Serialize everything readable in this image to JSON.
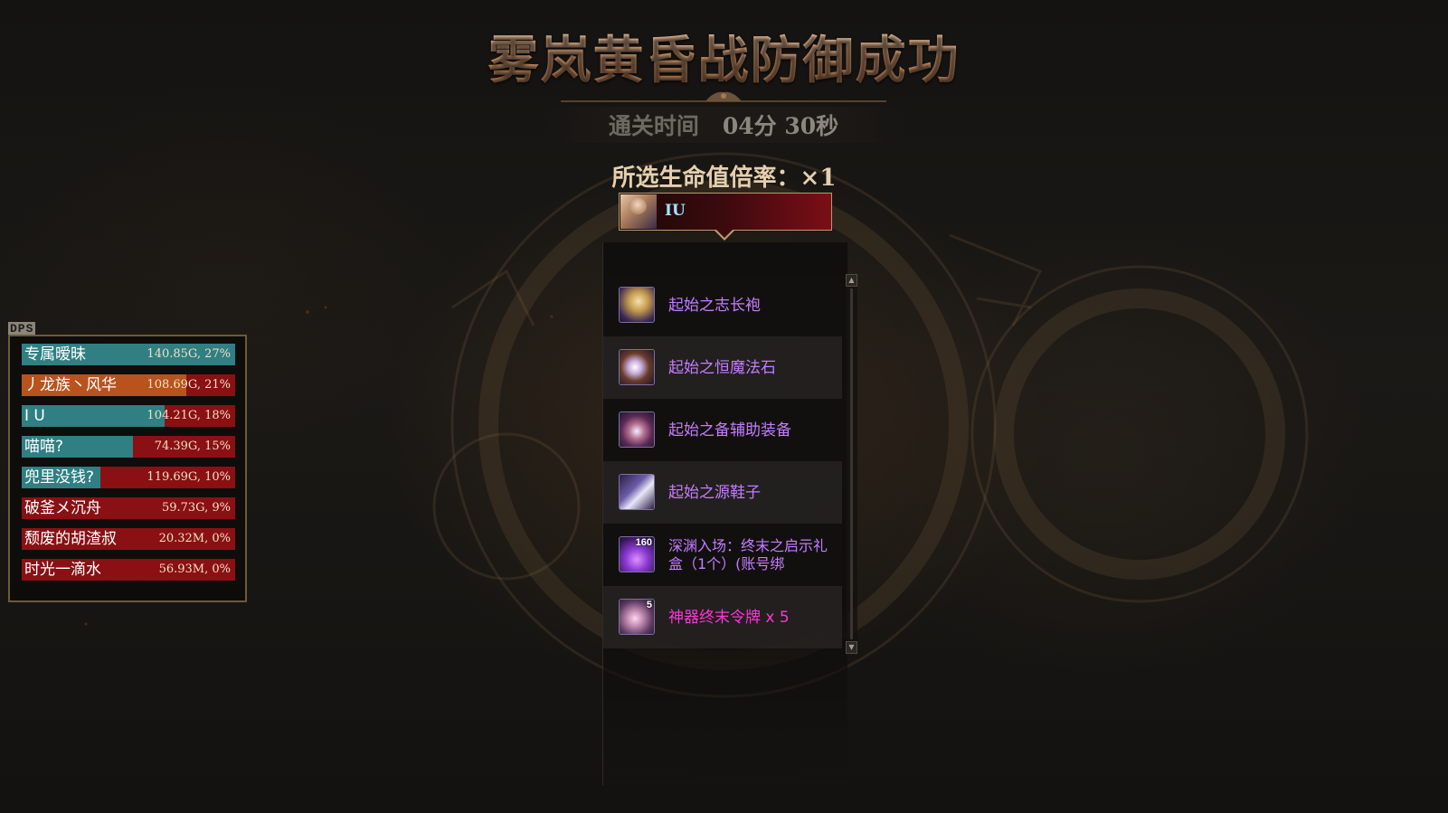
{
  "title": "雾岚黄昏战防御成功",
  "clear_time": {
    "label": "通关时间",
    "value": "04分 30秒"
  },
  "life_rate": "所选生命值倍率：×1",
  "player": {
    "name": "IU"
  },
  "colors": {
    "epic": "#c57cff",
    "legendary": "#ff35d8",
    "title_gold": "#d9a57a",
    "dps_red": "#8a1014",
    "dps_teal": "#2f7f83",
    "dps_orange": "#b9531e"
  },
  "rewards": [
    {
      "name": "起始之志长袍",
      "icon": "robe-icon",
      "rarity": "epic",
      "count": ""
    },
    {
      "name": "起始之恒魔法石",
      "icon": "magic-stone-icon",
      "rarity": "epic",
      "count": ""
    },
    {
      "name": "起始之备辅助装备",
      "icon": "support-gear-icon",
      "rarity": "epic",
      "count": ""
    },
    {
      "name": "起始之源鞋子",
      "icon": "boots-icon",
      "rarity": "epic",
      "count": ""
    },
    {
      "name": "深渊入场：终末之启示礼盒（1个）(账号绑",
      "icon": "gift-box-icon",
      "rarity": "epic",
      "count": "160"
    },
    {
      "name": "神器终末令牌 x 5",
      "icon": "token-icon",
      "rarity": "legendary",
      "count": "5"
    }
  ],
  "dps": {
    "label": "DPS",
    "rows": [
      {
        "name": "专属暧昧",
        "value": "140.85G, 27%",
        "fill": 1.0,
        "fill_color": "teal"
      },
      {
        "name": "丿龙族丶风华",
        "value": "108.69G, 21%",
        "fill": 0.77,
        "fill_color": "orange"
      },
      {
        "name": "I U",
        "value": "104.21G, 18%",
        "fill": 0.67,
        "fill_color": "teal"
      },
      {
        "name": "喵喵?",
        "value": "74.39G, 15%",
        "fill": 0.52,
        "fill_color": "teal"
      },
      {
        "name": "兜里没钱?",
        "value": "119.69G, 10%",
        "fill": 0.37,
        "fill_color": "teal"
      },
      {
        "name": "破釜メ沉舟",
        "value": "59.73G, 9%",
        "fill": 0.0,
        "fill_color": "teal"
      },
      {
        "name": "颓废的胡渣叔",
        "value": "20.32M, 0%",
        "fill": 0.0,
        "fill_color": "teal"
      },
      {
        "name": "时光一滴水",
        "value": "56.93M, 0%",
        "fill": 0.0,
        "fill_color": "teal"
      }
    ]
  }
}
